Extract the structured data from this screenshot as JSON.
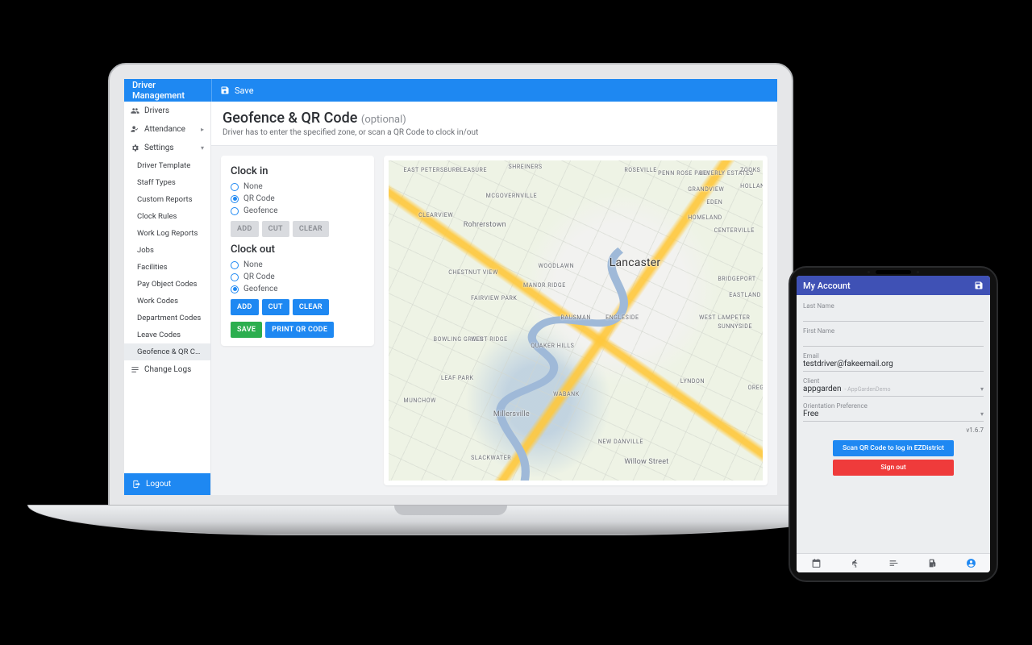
{
  "desktop": {
    "app_title": "Driver Management",
    "save_label": "Save",
    "sidebar": {
      "drivers": "Drivers",
      "attendance": "Attendance",
      "settings": "Settings",
      "subs": [
        "Driver Template",
        "Staff Types",
        "Custom Reports",
        "Clock Rules",
        "Work Log Reports",
        "Jobs",
        "Facilities",
        "Pay Object Codes",
        "Work Codes",
        "Department Codes",
        "Leave Codes",
        "Geofence & QR Code"
      ],
      "active_sub_index": 11,
      "change_logs": "Change Logs",
      "logout": "Logout"
    },
    "page": {
      "title": "Geofence & QR Code",
      "title_suffix": "(optional)",
      "subtitle": "Driver has to enter the specified zone, or scan a QR Code to clock in/out"
    },
    "controls": {
      "clock_in_heading": "Clock in",
      "clock_out_heading": "Clock out",
      "options": [
        "None",
        "QR Code",
        "Geofence"
      ],
      "clock_in_selected": 1,
      "clock_out_selected": 2,
      "btn_add": "ADD",
      "btn_cut": "CUT",
      "btn_clear": "CLEAR",
      "btn_save": "SAVE",
      "btn_print_qr": "PRINT QR CODE"
    },
    "map_labels": {
      "lancaster": "Lancaster",
      "millersville": "Millersville",
      "rohrerstown": "Rohrerstown",
      "willow_street": "Willow Street",
      "places_tiny": [
        "EAST PETERSBURG",
        "PLEASURE",
        "SHREINERS",
        "ROSEVILLE",
        "PENN ROSE PARK",
        "BEVERLY ESTATES",
        "ZOOKS CORNER",
        "HOLLAND HEIGHTS",
        "MCGOVERNVILLE",
        "GRANDVIEW",
        "CLEARVIEW",
        "EDEN",
        "HOMELAND",
        "CENTERVILLE",
        "CHESTNUT VIEW",
        "WOODLAWN",
        "MANOR RIDGE",
        "BRIDGEPORT",
        "EASTLAND HILLS",
        "FAIRVIEW PARK",
        "WEST LAMPETER",
        "BAUSMAN",
        "ENGLESIDE",
        "SUNNYSIDE",
        "BOWLING GREEN",
        "WEST RIDGE",
        "QUAKER HILLS",
        "LEAF PARK",
        "MUNCHOW",
        "WABANK",
        "LYNDON",
        "OREGON",
        "NEW DANVILLE",
        "SLACKWATER"
      ]
    }
  },
  "tablet": {
    "header_title": "My Account",
    "fields": {
      "last_name": {
        "label": "Last Name",
        "value": ""
      },
      "first_name": {
        "label": "First Name",
        "value": ""
      },
      "email": {
        "label": "Email",
        "value": "testdriver@fakeemail.org"
      },
      "client": {
        "label": "Client",
        "value": "appgarden",
        "suffix": "- AppGardenDemo"
      },
      "orientation": {
        "label": "Orientation Preference",
        "value": "Free"
      }
    },
    "version": "v1.6.7",
    "btn_scan": "Scan QR Code to log in EZDistrict",
    "btn_signout": "Sign out"
  }
}
